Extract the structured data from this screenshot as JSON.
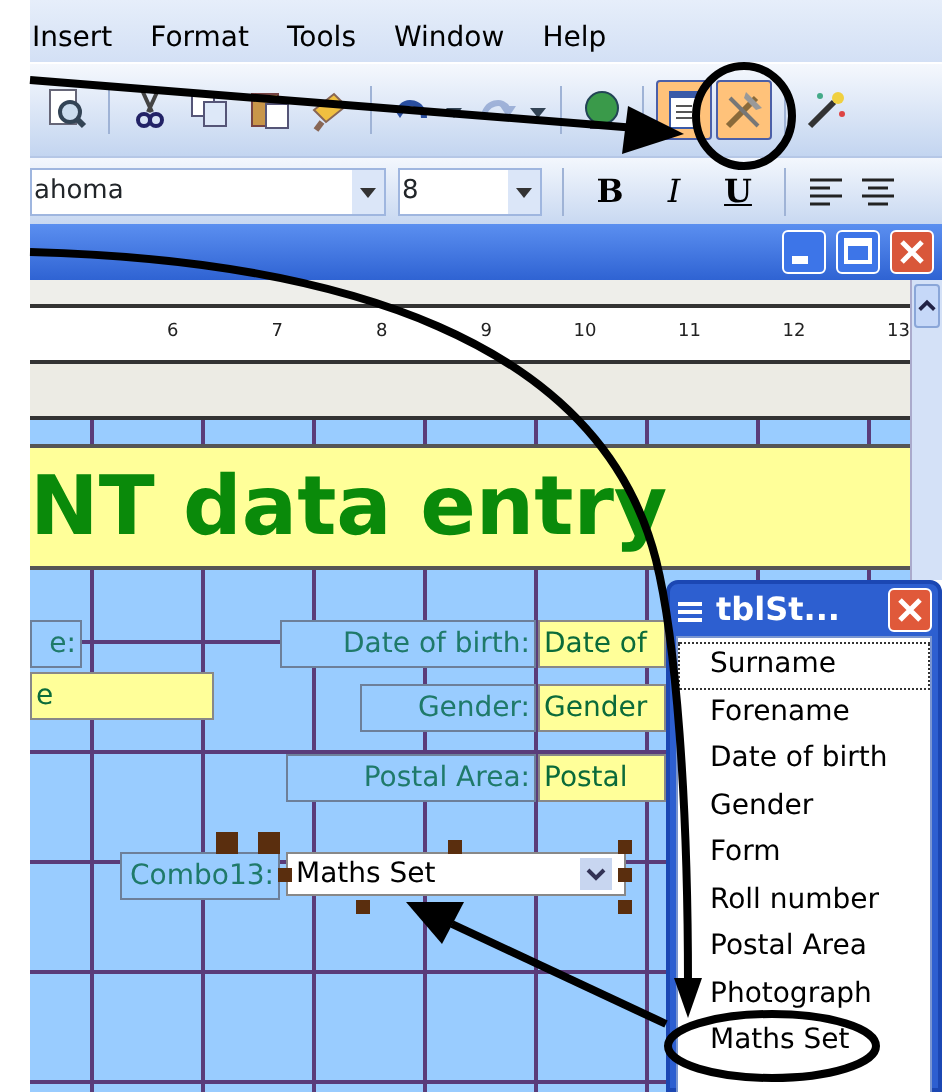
{
  "menu": [
    {
      "label": "Insert"
    },
    {
      "label": "Format"
    },
    {
      "label": "Tools"
    },
    {
      "label": "Window"
    },
    {
      "label": "Help"
    }
  ],
  "toolbar": [
    {
      "pressed": false,
      "disabled": false
    },
    {
      "pressed": false,
      "disabled": false
    },
    {
      "pressed": false,
      "disabled": false
    },
    {
      "pressed": false,
      "disabled": false
    },
    {
      "pressed": false,
      "disabled": false
    },
    {
      "pressed": false,
      "disabled": false
    },
    {
      "pressed": false,
      "disabled": true
    },
    {
      "pressed": false,
      "disabled": false
    },
    {
      "pressed": true,
      "disabled": false
    },
    {
      "pressed": true,
      "disabled": false
    },
    {
      "pressed": false,
      "disabled": false
    }
  ],
  "formatting": {
    "font": "ahoma",
    "size": "8",
    "styles": [
      "B",
      "I",
      "U"
    ]
  },
  "form_window": {
    "ruler": [
      "6",
      "7",
      "8",
      "9",
      "10",
      "11",
      "12",
      "13"
    ],
    "heading": "NT data entry",
    "controls": [
      {
        "kind": "label",
        "text": "e:"
      },
      {
        "kind": "textbox",
        "text": "e"
      },
      {
        "kind": "label",
        "text": "Date of birth:"
      },
      {
        "kind": "textbox",
        "text": "Date of"
      },
      {
        "kind": "label",
        "text": "Gender:"
      },
      {
        "kind": "textbox",
        "text": "Gender"
      },
      {
        "kind": "label",
        "text": "Postal Area:"
      },
      {
        "kind": "textbox",
        "text": "Postal"
      },
      {
        "kind": "label",
        "text": "Combo13:"
      },
      {
        "kind": "combo",
        "text": "Maths Set",
        "selected": true
      }
    ]
  },
  "field_list": {
    "title": "tblSt...",
    "items": [
      {
        "label": "Surname",
        "focused": true
      },
      {
        "label": "Forename",
        "focused": false
      },
      {
        "label": "Date of birth",
        "focused": false
      },
      {
        "label": "Gender",
        "focused": false
      },
      {
        "label": "Form",
        "focused": false
      },
      {
        "label": "Roll number",
        "focused": false
      },
      {
        "label": "Postal Area",
        "focused": false
      },
      {
        "label": "Photograph",
        "focused": false
      },
      {
        "label": "Maths Set",
        "focused": false
      }
    ]
  }
}
